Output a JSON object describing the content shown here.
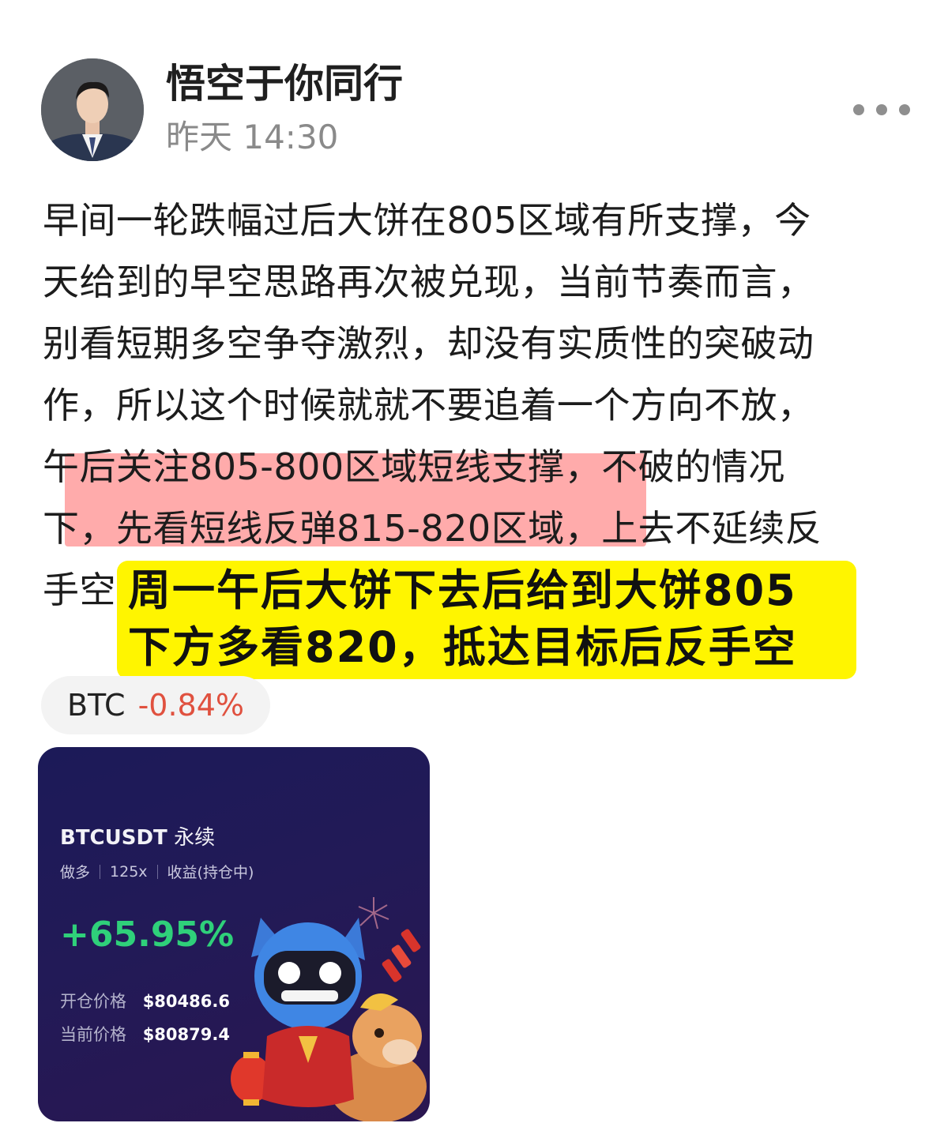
{
  "header": {
    "username": "悟空于你同行",
    "time": "昨天 14:30"
  },
  "post": {
    "lines": [
      "早间一轮跌幅过后大饼在805区域有所支撑，今",
      "天给到的早空思路再次被兑现，当前节奏而言，",
      "别看短期多空争夺激烈，却没有实质性的突破动",
      "作，所以这个时候就就不要追着一个方向不放，",
      "午后关注805-800区域短线支撑，不破的情况",
      "下，先看短线反弹815-820区域，上去不延续反",
      "手空"
    ]
  },
  "sticker": {
    "line1": "周一午后大饼下去后给到大饼805",
    "line2": "下方多看820，抵达目标后反手空",
    "color": "#fff500"
  },
  "ticker": {
    "symbol": "BTC",
    "change": "-0.84%",
    "change_color": "#e0513f"
  },
  "card": {
    "pair": "BTCUSDT",
    "contract": "永续",
    "side": "做多",
    "leverage": "125x",
    "status": "收益(持仓中)",
    "pnl": "+65.95%",
    "entry_label": "开仓价格",
    "entry_value": "$80486.6",
    "current_label": "当前价格",
    "current_value": "$80879.4",
    "pnl_color": "#2fd07a"
  },
  "icons": {
    "more": "more-dots-icon",
    "avatar": "user-avatar-image",
    "mascot": "mascot-illustration"
  }
}
